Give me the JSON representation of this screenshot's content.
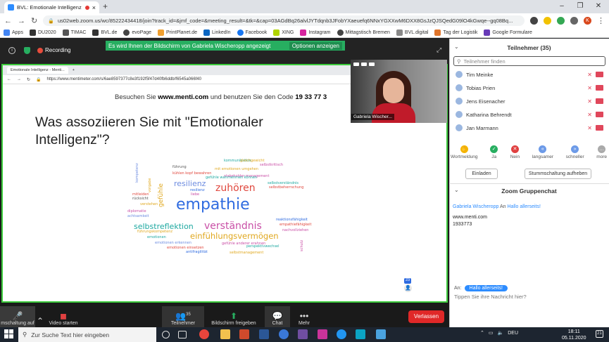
{
  "browser": {
    "tab_title": "BVL: Emotionale Intelligenz ...",
    "url": "us02web.zoom.us/wc/85222434418/join?track_id=&jmf_code=&meeting_result=&tk=&cap=03AGdBq26alvlJYTdqnb3JFobYXaeuefq6NNxYGXXwM6DXX8GsJzQJSQedG09lO4kGwqe--gq08Bq...",
    "bookmarks": [
      "Apps",
      "DU2020",
      "TIMAC",
      "BVL.de",
      "evoPage",
      "PrintPlanet.de",
      "LinkedIn",
      "Facebook",
      "XING",
      "Instagram",
      "Mittagstisch Bremen",
      "BVL.digital",
      "Tag der Logistik",
      "Google Formulare"
    ],
    "profile_initial": "K"
  },
  "zoom": {
    "recording_label": "Recording",
    "share_banner": "Es wird Ihnen der Bildschirm von Gabriela Wischeropp angezeigt",
    "share_options": "Optionen anzeigen",
    "video_name": "Gabriela Wischer...",
    "toolbar": {
      "mute": "mschaltung auf",
      "video": "Video starten",
      "participants": "Teilnehmer",
      "participants_count": "35",
      "share": "Bildschirm freigeben",
      "chat": "Chat",
      "more": "Mehr",
      "leave": "Verlassen"
    }
  },
  "shared": {
    "tab_title": "Emotionale Intelligenz - Menti...",
    "url": "https://www.mentimeter.com/s/6ae8597377c8e3f192f5f47d40fb6ddb/f6545a066f40",
    "visit_pre": "Besuchen Sie",
    "visit_site": "www.menti.com",
    "visit_mid": "und benutzen Sie den Code",
    "visit_code": "19 33 77 3",
    "question": "Was assoziieren Sie mit \"Emotionaler Intelligenz\"?",
    "response_count": "23",
    "words": [
      {
        "t": "empathie",
        "c": "#2f6be0"
      },
      {
        "t": "verständnis",
        "c": "#c94fa6"
      },
      {
        "t": "zuhören",
        "c": "#e0473d"
      },
      {
        "t": "selbstreflektion",
        "c": "#1da8a0"
      },
      {
        "t": "einfühlungsvermögen",
        "c": "#e0a81f"
      },
      {
        "t": "resilienz",
        "c": "#6d8ce0"
      },
      {
        "t": "gefühle",
        "c": "#e0a81f"
      },
      {
        "t": "kommunikation",
        "c": "#1da8a0"
      },
      {
        "t": "gleichgewicht",
        "c": "#e0a81f"
      },
      {
        "t": "selbstkritisch",
        "c": "#c94fa6"
      },
      {
        "t": "führung",
        "c": "#555555"
      },
      {
        "t": "mit emotionen umgehen",
        "c": "#e0a81f"
      },
      {
        "t": "kühlen kopf bewahren",
        "c": "#e0473d"
      },
      {
        "t": "stakeholder management",
        "c": "#c94fa6"
      },
      {
        "t": "gefühle wahrnehmen können",
        "c": "#1da8a0"
      },
      {
        "t": "selbstverständnis",
        "c": "#1da8a0"
      },
      {
        "t": "selbstbeherrschung",
        "c": "#e0473d"
      },
      {
        "t": "resilienz",
        "c": "#2f6be0"
      },
      {
        "t": "liebe",
        "c": "#c94fa6"
      },
      {
        "t": "mitleiden",
        "c": "#e0473d"
      },
      {
        "t": "rücksicht",
        "c": "#555555"
      },
      {
        "t": "verstehen",
        "c": "#e0a81f"
      },
      {
        "t": "diplomatie",
        "c": "#c94fa6"
      },
      {
        "t": "achtsamkeit",
        "c": "#6d8ce0"
      },
      {
        "t": "kompetenz",
        "c": "#6d8ce0"
      },
      {
        "t": "vorgabe",
        "c": "#e0a81f"
      },
      {
        "t": "reaktionsfähigkeit",
        "c": "#2f6be0"
      },
      {
        "t": "empathiefähigkeit",
        "c": "#e0473d"
      },
      {
        "t": "nachvollziehen",
        "c": "#c94fa6"
      },
      {
        "t": "führungskompetenz",
        "c": "#e0a81f"
      },
      {
        "t": "emotionen",
        "c": "#1da8a0"
      },
      {
        "t": "emotionen erkennen",
        "c": "#6d8ce0"
      },
      {
        "t": "gefühle anderer erahnen",
        "c": "#c94fa6"
      },
      {
        "t": "perspektivwechsel",
        "c": "#1da8a0"
      },
      {
        "t": "emotionen einsetzen",
        "c": "#e0473d"
      },
      {
        "t": "antifragilität",
        "c": "#2f6be0"
      },
      {
        "t": "selbstmanagement",
        "c": "#e0a81f"
      },
      {
        "t": "schutz",
        "c": "#c94fa6"
      }
    ]
  },
  "participants": {
    "title": "Teilnehmer (35)",
    "search_placeholder": "Teilnehmer finden",
    "list": [
      "Tim Meinke",
      "Tobias Prien",
      "Jens Eisenacher",
      "Katharina Behrendt",
      "Jan Marmann"
    ],
    "reactions": [
      "Wortmeldung",
      "Ja",
      "Nein",
      "langsamer",
      "schneller",
      "more"
    ],
    "invite": "Einladen",
    "unmute_all": "Stummschaltung aufheben"
  },
  "chat": {
    "title": "Zoom Gruppenchat",
    "sender": "Gabriela Wischeropp",
    "to_word": "An",
    "recipient": "Hallo allerseits!",
    "message_line1": "www.menti.com",
    "message_line2": "1933773",
    "to_label": "An:",
    "to_pill": "Hallo allerseits!",
    "input_placeholder": "Tippen Sie ihre Nachricht hier?"
  },
  "taskbar": {
    "search_placeholder": "Zur Suche Text hier eingeben",
    "lang": "DEU",
    "time": "18:11",
    "date": "05.11.2020",
    "notif_count": "21"
  }
}
